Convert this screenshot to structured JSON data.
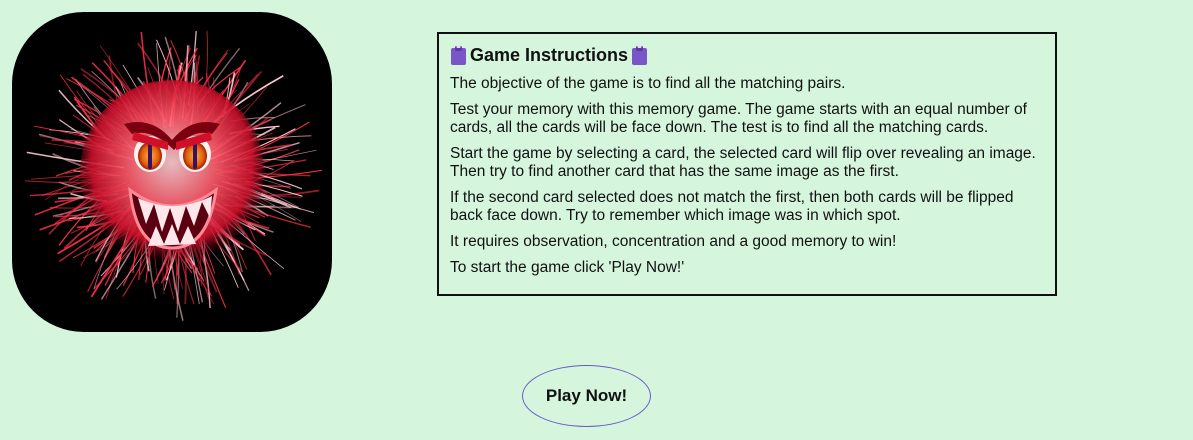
{
  "monster": {
    "icon": "furry-red-monster-icon",
    "background_color": "#000000"
  },
  "instructions": {
    "title": "Game Instructions",
    "icon": "clipboard-icon",
    "icon_color": "#7a55c8",
    "paragraphs": [
      "The objective of the game is to find all the matching pairs.",
      "Test your memory with this memory game. The game starts with an equal number of cards, all the cards will be face down. The test is to find all the matching cards.",
      "Start the game by selecting a card, the selected card will flip over revealing an image. Then try to find another card that has the same image as the first.",
      "If the second card selected does not match the first, then both cards will be flipped back face down. Try to remember which image was in which spot.",
      "It requires observation, concentration and a good memory to win!",
      "To start the game click 'Play Now!'"
    ]
  },
  "play_button": {
    "label": "Play Now!",
    "border_color": "#6a5acd"
  },
  "colors": {
    "page_background": "#d5f5dd",
    "monster_red": "#e8283c"
  }
}
